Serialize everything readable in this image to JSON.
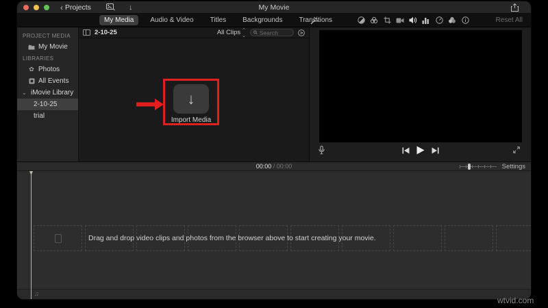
{
  "titlebar": {
    "back_label": "Projects",
    "title": "My Movie",
    "icons": [
      "media-browser-icon",
      "import-arrow-icon",
      "share-icon"
    ]
  },
  "tabs": {
    "items": [
      {
        "label": "My Media",
        "active": true
      },
      {
        "label": "Audio & Video",
        "active": false
      },
      {
        "label": "Titles",
        "active": false
      },
      {
        "label": "Backgrounds",
        "active": false
      },
      {
        "label": "Transitions",
        "active": false
      }
    ]
  },
  "adjust_toolbar": {
    "icons": [
      "enhance-wand",
      "color-balance",
      "color-correction",
      "crop",
      "stabilization",
      "volume",
      "noise-equalizer",
      "speed",
      "effects",
      "clip-info"
    ],
    "reset_label": "Reset All"
  },
  "sidebar": {
    "section1_header": "PROJECT MEDIA",
    "item_my_movie": "My Movie",
    "section2_header": "LIBRARIES",
    "item_photos": "Photos",
    "item_all_events": "All Events",
    "item_imovie_library": "iMovie Library",
    "item_event": "2-10-25",
    "item_trial": "trial"
  },
  "browser": {
    "title": "2-10-25",
    "filter_label": "All Clips",
    "search_placeholder": "Search",
    "import_label": "Import Media"
  },
  "timeline_toolbar": {
    "time_current": "00:00",
    "time_separator": "/",
    "time_total": "00:00",
    "settings_label": "Settings"
  },
  "timeline": {
    "message": "Drag and drop video clips and photos from the browser above to start creating your movie.",
    "placeholder_count": 10
  },
  "annotation": {
    "color": "#e01f1f",
    "type": "red-rectangle-and-arrow-pointing-at-import-media"
  },
  "watermark": "wtvid.com",
  "colors": {
    "window_bg": "#1f1f1f",
    "sidebar_bg": "#262626",
    "browser_bg": "#1a1a1a",
    "timeline_bg": "#2d2d2d",
    "selected_row": "#3f3f3f",
    "active_tab": "#3d3d3d",
    "traffic_red": "#ec6a5e",
    "traffic_yellow": "#f5bf4f",
    "traffic_green": "#61c454"
  }
}
